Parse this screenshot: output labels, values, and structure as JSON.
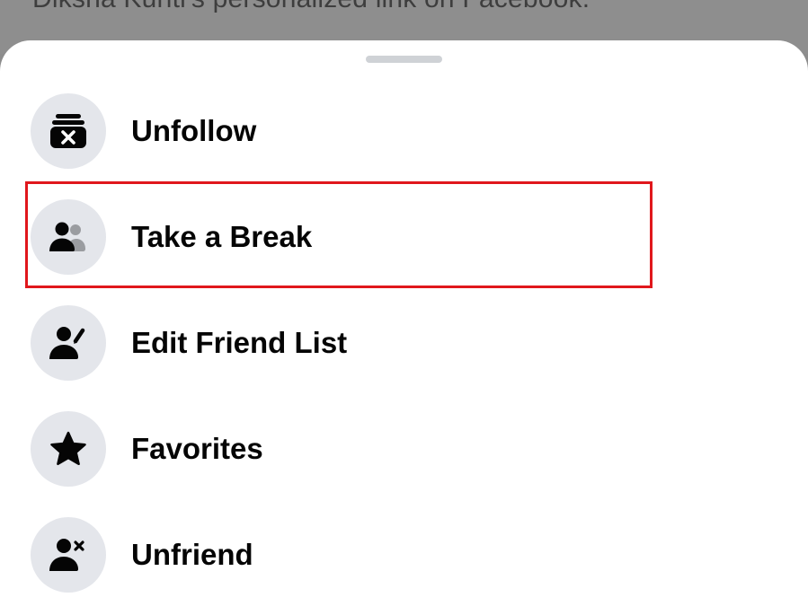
{
  "backdrop": {
    "text": "Diksha Kuriti's personalized link on Facebook."
  },
  "menu": {
    "items": [
      {
        "label": "Unfollow",
        "icon": "unfollow-icon"
      },
      {
        "label": "Take a Break",
        "icon": "take-a-break-icon"
      },
      {
        "label": "Edit Friend List",
        "icon": "edit-friend-list-icon"
      },
      {
        "label": "Favorites",
        "icon": "star-icon"
      },
      {
        "label": "Unfriend",
        "icon": "unfriend-icon"
      }
    ],
    "highlighted_item": "Take a Break"
  },
  "colors": {
    "highlight_border": "#e0171c",
    "icon_background": "#e4e6eb",
    "text": "#050505"
  }
}
